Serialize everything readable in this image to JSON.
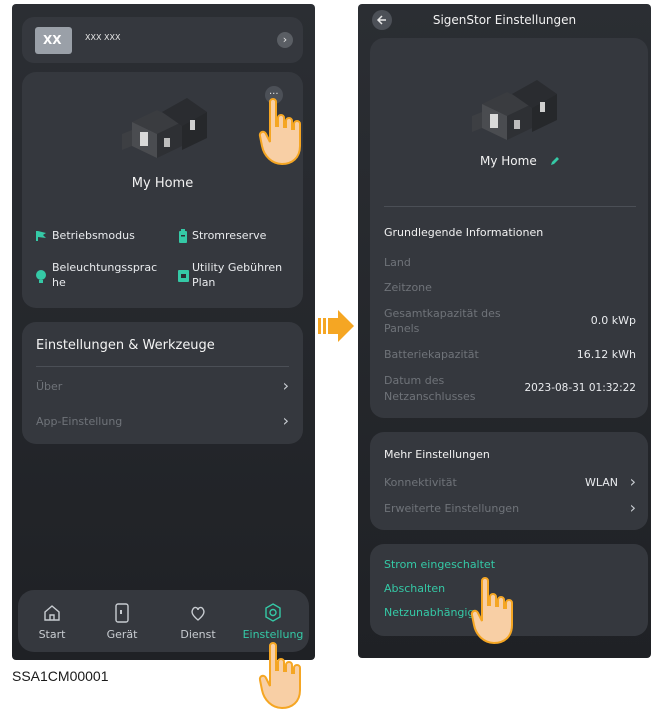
{
  "left": {
    "account": {
      "badge": "XX",
      "name": "XXX XXX"
    },
    "home": {
      "name": "My Home",
      "more_label": "...",
      "features": [
        {
          "label": "Betriebsmodus",
          "icon": "flag-icon"
        },
        {
          "label": "Stromreserve",
          "icon": "battery-icon"
        },
        {
          "label_line1": "Beleuchtungssprac",
          "label_line2": "he",
          "icon": "bulb-icon"
        },
        {
          "label_line1": "Utility Gebühren",
          "label_line2": "Plan",
          "icon": "calendar-icon"
        }
      ]
    },
    "tools": {
      "title": "Einstellungen & Werkzeuge",
      "items": [
        {
          "label": "Über"
        },
        {
          "label": "App-Einstellung"
        }
      ]
    },
    "nav": [
      {
        "label": "Start",
        "icon": "home-icon"
      },
      {
        "label": "Gerät",
        "icon": "device-icon"
      },
      {
        "label": "Dienst",
        "icon": "service-icon"
      },
      {
        "label": "Einstellung",
        "icon": "settings-icon",
        "active": true
      }
    ]
  },
  "caption": "SSA1CM00001",
  "right": {
    "header_title": "SigenStor Einstellungen",
    "home_name": "My Home",
    "basic": {
      "title": "Grundlegende Informationen",
      "rows": [
        {
          "label": "Land",
          "value": ""
        },
        {
          "label": "Zeitzone",
          "value": ""
        },
        {
          "label_line1": "Gesamtkapazität des",
          "label_line2": "Panels",
          "value": "0.0 kWp"
        },
        {
          "label": "Batteriekapazität",
          "value": "16.12 kWh"
        },
        {
          "label_line1": "Datum des",
          "label_line2": "Netzanschlusses",
          "value": "2023-08-31 01:32:22"
        }
      ]
    },
    "more": {
      "title": "Mehr Einstellungen",
      "rows": [
        {
          "label": "Konnektivität",
          "value": "WLAN"
        },
        {
          "label": "Erweiterte Einstellungen",
          "value": ""
        }
      ]
    },
    "power": {
      "items": [
        "Strom eingeschaltet",
        "Abschalten",
        "Netzunabhängig"
      ]
    }
  },
  "colors": {
    "accent": "#35c9a6",
    "card": "#35383e",
    "background": "#24272b",
    "arrow": "#f5a623",
    "hand": "#f8cfa5"
  }
}
